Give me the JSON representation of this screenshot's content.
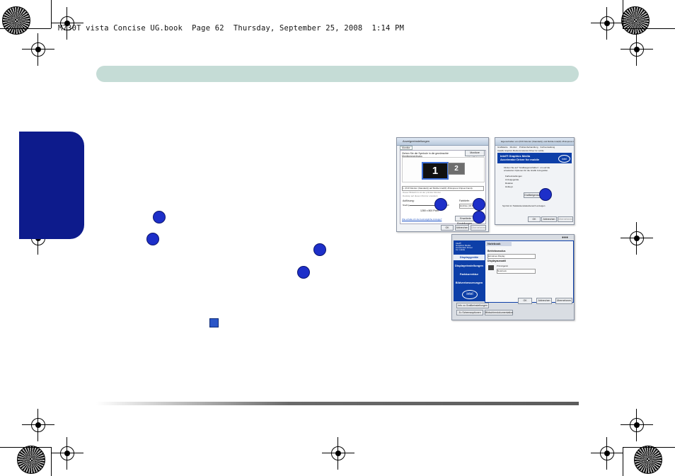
{
  "header": {
    "book_line": "M730T vista Concise UG.book  Page 62  Thursday, September 25, 2008  1:14 PM"
  },
  "windows": {
    "display_settings": {
      "title": "Anzeigeeinstellungen",
      "tab": "Monitor",
      "instruction": "Ziehen Sie die Symbole in die gewünschte Monitoranordnung.",
      "identify_button": "Monitore identifizieren",
      "monitor_1": "1",
      "monitor_2": "2",
      "monitor_select": "1. (PnP-Monitor (Standard)) auf Mobile Intel(R) 45 Express Chipset Family",
      "checkbox_primary": "Dieser Bildschirm ist der primäre Monitor",
      "checkbox_extend": "Desktop auf diesen Monitor erweitern",
      "resolution_label": "Auflösung:",
      "resolution_low": "Niedrig",
      "resolution_high": "Hoch",
      "resolution_value": "1280 x 800 Pixel",
      "colors_label": "Farbtiefe:",
      "colors_value": "Höchste (32 Bit)",
      "advanced_button": "Erweiterte Einstellungen...",
      "help_link": "Wie erhalte ich die bestmögliche Anzeige?",
      "ok_button": "OK",
      "cancel_button": "Abbrechen",
      "apply_button": "Übernehmen"
    },
    "properties": {
      "title": "Eigenschaften von (PnP-Monitor (Standard)) und Mobile Intel(R) 45 Express Chipset",
      "tabs": [
        "Grafikkarte",
        "Monitor",
        "Problembehandlung",
        "Farbverwaltung"
      ],
      "subtab": "Intel(R) Graphics Media Accelerator Driver for mobile",
      "brand_line1": "Intel® Graphics Media",
      "brand_line2": "Accelerator Driver for mobile",
      "brand_logo": "intel",
      "description": "Klicken Sie auf \"Grafikeigenschaften\", um auf die erweiterten Optionen für die Grafik zuzugreifen.",
      "list_items": [
        "Farbeinstellungen",
        "Anzeigegeräte",
        "Rotation",
        "Hotkeys"
      ],
      "props_button": "Grafikeigenschaften...",
      "tray_checkbox": "Symbol im Taskleistenstatusbereich anzeigen",
      "ok_button": "OK",
      "cancel_button": "Abbrechen",
      "apply_button": "Übernehmen"
    },
    "intel_panel": {
      "brand_line1": "Intel®",
      "brand_line2": "Graphics Media",
      "brand_line3": "Accelerator Driver",
      "brand_line4": "for mobile",
      "brand_logo": "intel",
      "nav": [
        "Displaygeräte",
        "Displayeinstellungen",
        "Farbkorrektur",
        "Bildverbesserungen"
      ],
      "tab": "Notebook",
      "operating_mode_label": "Betriebsmodus",
      "operating_mode_value": "Einzelnes Display",
      "display_select_label": "Displayauswahl",
      "primary_label": "Primärgerät",
      "primary_value": "Notebook",
      "left_button_1": "Info zu Grafikeinstellungen",
      "left_button_2": "Zu Schemaoptionen",
      "left_button_3": "Bildschirmdokumentation",
      "ok_button": "OK",
      "cancel_button": "Abbrechen",
      "apply_button": "Übernehmen"
    }
  }
}
